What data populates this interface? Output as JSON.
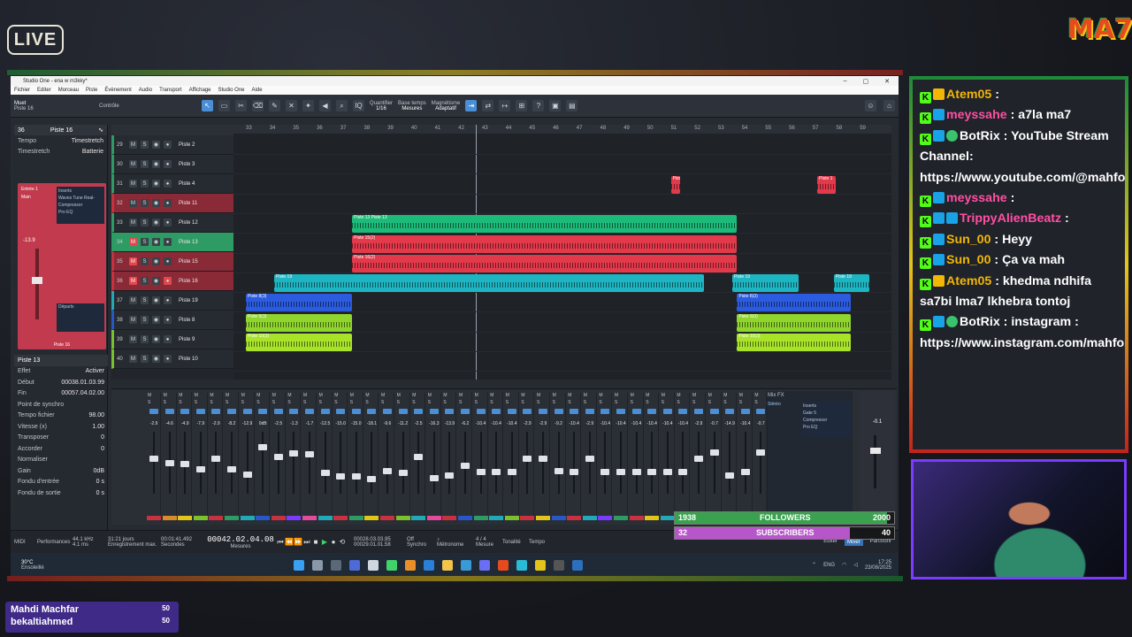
{
  "overlay": {
    "live_label": "LIVE",
    "brand": "MA7"
  },
  "daw": {
    "title": "Studio One - ena w m3kky*",
    "menu": [
      "Fichier",
      "Editer",
      "Morceau",
      "Piste",
      "Évènement",
      "Audio",
      "Transport",
      "Affichage",
      "Studio One",
      "Aide"
    ],
    "toolbar": {
      "track_mute_label": "Muet",
      "track_label": "Piste 16",
      "control_label": "Contrôle",
      "quantize_label": "Quantifier",
      "quantize_value": "1/16",
      "timebase_label": "Base temps",
      "timebase_value": "Mesures",
      "snap_label": "Magnétisme",
      "snap_value": "Adaptatif"
    },
    "inspector": {
      "track_number": "36",
      "track_name": "Piste 16",
      "tempo_label": "Tempo",
      "tempo_value": "Timestretch",
      "timestretch_label": "Timestretch",
      "timestretch_value": "Batterie",
      "input_label": "Entrée 1",
      "output_label": "Main",
      "inserts_label": "Inserts",
      "insert_1": "Waves Tune Real-",
      "insert_2": "Compressor",
      "insert_3": "Pro EQ",
      "sends_label": "Départs",
      "channel_name": "Piste 16",
      "channel_volume": "-13.9",
      "event_title": "Piste 13",
      "effect_label": "Effet",
      "effect_value": "Activer",
      "start_label": "Début",
      "start_value": "00038.01.03.99",
      "end_label": "Fin",
      "end_value": "00057.04.02.00",
      "sync_label": "Point de synchro",
      "file_tempo_label": "Tempo fichier",
      "file_tempo_value": "98.00",
      "speed_label": "Vitesse (x)",
      "speed_value": "1.00",
      "transpose_label": "Transposer",
      "transpose_value": "0",
      "tune_label": "Accorder",
      "tune_value": "0",
      "normalize_label": "Normaliser",
      "gain_label": "Gain",
      "gain_value": "0dB",
      "fade_in_label": "Fondu d'entrée",
      "fade_in_value": "0 s",
      "fade_out_label": "Fondu de sortie",
      "fade_out_value": "0 s"
    },
    "ruler": [
      "33",
      "34",
      "35",
      "36",
      "37",
      "38",
      "39",
      "40",
      "41",
      "42",
      "43",
      "44",
      "45",
      "46",
      "47",
      "48",
      "49",
      "50",
      "51",
      "52",
      "53",
      "54",
      "55",
      "56",
      "57",
      "58",
      "59"
    ],
    "tracks": [
      {
        "num": "29",
        "name": "Piste 2",
        "color": "#2f9b64",
        "mute": false,
        "rec": false
      },
      {
        "num": "30",
        "name": "Piste 3",
        "color": "#2f9b64",
        "mute": false,
        "rec": false
      },
      {
        "num": "31",
        "name": "Piste 4",
        "color": "#2f9b64",
        "mute": false,
        "rec": false
      },
      {
        "num": "32",
        "name": "Piste 11",
        "color": "#c8313f",
        "mute": false,
        "rec": false
      },
      {
        "num": "33",
        "name": "Piste 12",
        "color": "#2f9b64",
        "mute": false,
        "rec": false
      },
      {
        "num": "34",
        "name": "Piste 13",
        "color": "#2f9b64",
        "mute": true,
        "rec": false
      },
      {
        "num": "35",
        "name": "Piste 15",
        "color": "#c8313f",
        "mute": true,
        "rec": false
      },
      {
        "num": "36",
        "name": "Piste 16",
        "color": "#c8313f",
        "mute": true,
        "rec": true
      },
      {
        "num": "37",
        "name": "Piste 19",
        "color": "#22a9b8",
        "mute": false,
        "rec": false
      },
      {
        "num": "38",
        "name": "Piste 8",
        "color": "#2757c9",
        "mute": false,
        "rec": false
      },
      {
        "num": "39",
        "name": "Piste 9",
        "color": "#7ac22d",
        "mute": false,
        "rec": false
      },
      {
        "num": "40",
        "name": "Piste 10",
        "color": "#7ac22d",
        "mute": false,
        "rec": false
      }
    ],
    "clips": [
      {
        "lane": 3,
        "start": 51,
        "len": 0.4,
        "color": "#e2394b",
        "title": "Pist"
      },
      {
        "lane": 3,
        "start": 57.2,
        "len": 0.8,
        "color": "#e2394b",
        "title": "Piste 1"
      },
      {
        "lane": 5,
        "start": 37.5,
        "len": 16.3,
        "color": "#1dbb79",
        "title": "Piste 13  Piste 13"
      },
      {
        "lane": 6,
        "start": 37.5,
        "len": 16.3,
        "color": "#e2394b",
        "title": "Piste 15(2)"
      },
      {
        "lane": 7,
        "start": 37.5,
        "len": 16.3,
        "color": "#e2394b",
        "title": "Piste 16(2)"
      },
      {
        "lane": 8,
        "start": 34.2,
        "len": 18.2,
        "color": "#1eb5c2",
        "title": "Piste 19"
      },
      {
        "lane": 8,
        "start": 53.6,
        "len": 2.8,
        "color": "#1eb5c2",
        "title": "Piste 19"
      },
      {
        "lane": 8,
        "start": 57.9,
        "len": 1.5,
        "color": "#1eb5c2",
        "title": "Piste 19"
      },
      {
        "lane": 9,
        "start": 33,
        "len": 4.5,
        "color": "#2b5ce0",
        "title": "Piste 8(3)"
      },
      {
        "lane": 9,
        "start": 53.8,
        "len": 4.8,
        "color": "#2b5ce0",
        "title": "Piste 8(3)"
      },
      {
        "lane": 10,
        "start": 33,
        "len": 4.5,
        "color": "#8fd52c",
        "title": "Piste 9(3)"
      },
      {
        "lane": 10,
        "start": 53.8,
        "len": 4.8,
        "color": "#8fd52c",
        "title": "Piste 9(3)"
      },
      {
        "lane": 11,
        "start": 33,
        "len": 4.5,
        "color": "#a8e32a",
        "title": "Piste 10(3)"
      },
      {
        "lane": 11,
        "start": 53.8,
        "len": 4.8,
        "color": "#a8e32a",
        "title": "Piste 10(3)"
      }
    ],
    "mixer": {
      "volumes": [
        "-2.9",
        "-4.6",
        "-4.9",
        "-7.9",
        "-2.9",
        "-8.2",
        "-12.9",
        "0dB",
        "-2.5",
        "-1.3",
        "-1.7",
        "-12.5",
        "-15.0",
        "-15.0",
        "-18.1",
        "-9.6",
        "-11.2",
        "-2.5",
        "-16.3",
        "-13.9",
        "-6.2",
        "-10.4",
        "-10.4",
        "-10.4",
        "-2.9",
        "-2.9",
        "-9.2",
        "-10.4",
        "-2.9",
        "-10.4",
        "-10.4",
        "-10.4",
        "-10.4",
        "-10.4",
        "-10.4",
        "-2.9",
        "-0.7",
        "-14.9",
        "-10.4",
        "-0.7"
      ],
      "labels_colors": [
        "#c8313f",
        "#d98a2b",
        "#e2c41b",
        "#7ac22d",
        "#c8313f",
        "#2f9b64",
        "#22a9b8",
        "#2757c9",
        "#c8313f",
        "#7a3cff",
        "#e64a9c",
        "#22a9b8",
        "#c8313f",
        "#2f9b64",
        "#e2c41b",
        "#c8313f",
        "#7ac22d",
        "#22a9b8",
        "#e64a9c",
        "#c8313f",
        "#2757c9",
        "#2f9b64",
        "#22a9b8",
        "#7ac22d",
        "#c8313f",
        "#e2c41b",
        "#2757c9",
        "#c8313f",
        "#22a9b8",
        "#7a3cff",
        "#2f9b64",
        "#c8313f",
        "#e2c41b",
        "#22a9b8",
        "#2757c9",
        "#c8313f",
        "#7ac22d",
        "#22a9b8",
        "#c8313f",
        "#2757c9"
      ],
      "fader_levels": [
        0.62,
        0.55,
        0.53,
        0.45,
        0.62,
        0.44,
        0.36,
        0.8,
        0.64,
        0.7,
        0.68,
        0.38,
        0.33,
        0.33,
        0.28,
        0.42,
        0.39,
        0.64,
        0.3,
        0.35,
        0.5,
        0.4,
        0.4,
        0.4,
        0.62,
        0.62,
        0.42,
        0.4,
        0.62,
        0.4,
        0.4,
        0.4,
        0.4,
        0.4,
        0.4,
        0.62,
        0.72,
        0.34,
        0.4,
        0.72
      ],
      "fx_title": "Mix FX",
      "bus_name": "Stéréo",
      "bus_inserts": "Inserts",
      "bus_insert_1": "Gate 5",
      "bus_insert_2": "Compressor",
      "bus_insert_3": "Pro EQ",
      "main_volume": "-0.1"
    },
    "transport": {
      "midi_label": "MIDI",
      "performance_label": "Performances",
      "samplerate": "44.1 kHz",
      "latency": "4.1 ms",
      "record_time": "31:21 jours",
      "record_label": "Enregistrement max.",
      "seconds_value": "00:01:41.492",
      "seconds_label": "Secondes",
      "position": "00042.02.04.08",
      "position_label": "Mesures",
      "loop_start": "00028.03.03.95",
      "loop_end": "00029.01.01.58",
      "sync_label": "Synchro",
      "sync_value": "Off",
      "metronome_label": "Métronome",
      "signature": "4 / 4",
      "signature_label": "Mesure",
      "key_label": "Tonalité",
      "tempo_label": "Tempo",
      "edit_label": "Editer",
      "mix_label": "Mixer",
      "browse_label": "Parcourir"
    },
    "taskbar": {
      "weather_temp": "30°C",
      "weather_desc": "Ensoleillé",
      "lang": "ENG",
      "time": "17:25",
      "date": "23/08/2025"
    }
  },
  "stats": {
    "followers_current": "1938",
    "followers_label": "FOLLOWERS",
    "followers_goal": "2000",
    "followers_progress": 0.969,
    "followers_color": "#3aa24f",
    "subscribers_current": "32",
    "subscribers_label": "SUBSCRIBERS",
    "subscribers_goal": "40",
    "subscribers_progress": 0.8,
    "subscribers_color": "#b656c9"
  },
  "chat": [
    {
      "user": "Atem05",
      "user_color": "#f2b705",
      "sep": " : ",
      "text": "",
      "badges": [
        "k",
        "crown"
      ]
    },
    {
      "user": "meyssahe",
      "user_color": "#ff4fa3",
      "sep": " : ",
      "text": "a7la ma7",
      "badges": [
        "k",
        "gem"
      ]
    },
    {
      "user": "BotRix",
      "user_color": "#ffffff",
      "sep": " : ",
      "text": "YouTube Stream Channel: https://www.youtube.com/@mahfoudhistream",
      "badges": [
        "k",
        "gem",
        "check"
      ]
    },
    {
      "user": "meyssahe",
      "user_color": "#ff4fa3",
      "sep": " : ",
      "text": "",
      "badges": [
        "k",
        "gem"
      ]
    },
    {
      "user": "TrippyAlienBeatz",
      "user_color": "#ff4fa3",
      "sep": " : ",
      "text": "",
      "badges": [
        "k",
        "gem",
        "gem"
      ]
    },
    {
      "user": "Sun_00",
      "user_color": "#f2b705",
      "sep": " : ",
      "text": "Heyy",
      "badges": [
        "k",
        "gem"
      ]
    },
    {
      "user": "Sun_00",
      "user_color": "#f2b705",
      "sep": " : ",
      "text": "Ça va mah",
      "badges": [
        "k",
        "gem"
      ]
    },
    {
      "user": "Atem05",
      "user_color": "#f2b705",
      "sep": " : ",
      "text": "khedma ndhifa sa7bi lma7 lkhebra tontoj",
      "badges": [
        "k",
        "crown"
      ]
    },
    {
      "user": "BotRix",
      "user_color": "#ffffff",
      "sep": " : ",
      "text": "instagram : https://www.instagram.com/mahfoudhi_tn/",
      "badges": [
        "k",
        "gem",
        "check"
      ]
    }
  ],
  "donors": [
    {
      "name": "Mahdi Machfar",
      "amount": "50"
    },
    {
      "name": "bekaltiahmed",
      "amount": "50"
    }
  ]
}
